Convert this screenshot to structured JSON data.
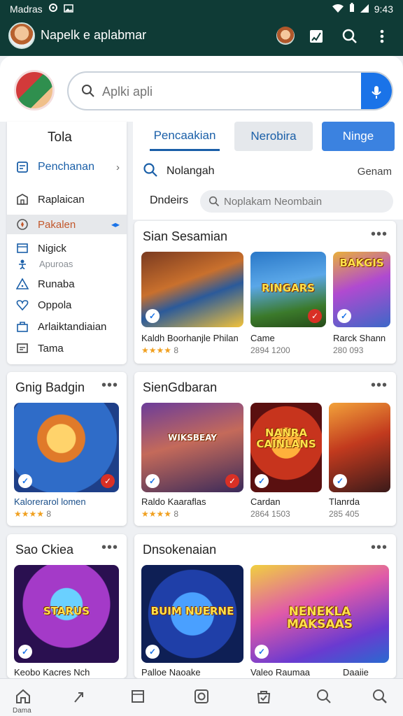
{
  "status_bar": {
    "carrier": "Madras",
    "time": "9:43"
  },
  "app_bar": {
    "title": "Napelk e aplabmar"
  },
  "search": {
    "placeholder": "Aplki apli"
  },
  "sidebar": {
    "heading": "Tola",
    "items": [
      {
        "label": "Penchanan",
        "icon": "tablet-icon"
      },
      {
        "label": "Raplaican",
        "icon": "building-icon"
      },
      {
        "label": "Pakalen",
        "icon": "compass-icon"
      },
      {
        "label": "Nigick",
        "icon": "window-icon"
      },
      {
        "label": "Apuroas",
        "icon": "person-icon"
      },
      {
        "label": "Runaba",
        "icon": "warning-icon"
      },
      {
        "label": "Oppola",
        "icon": "heart-icon"
      },
      {
        "label": "Arlaiktandiaian",
        "icon": "bag-icon"
      },
      {
        "label": "Tama",
        "icon": "id-card-icon"
      }
    ]
  },
  "tabs": [
    "Pencaakian",
    "Nerobira",
    "Ninge"
  ],
  "search_row": {
    "label": "Nolangah",
    "right_label": "Genam"
  },
  "filter_row": {
    "label": "Dndeirs",
    "placeholder": "Noplakam Neombain"
  },
  "cards": {
    "c1": {
      "title": "Sian Sesamian",
      "tiles": [
        {
          "name": "Kaldh Boorhanjle Philan",
          "meta": "8",
          "rating": "★★★★",
          "banner": ""
        },
        {
          "name": "Came",
          "meta": "2894 1200",
          "rating": "",
          "banner": "RINGARS"
        },
        {
          "name": "Rarck Shann",
          "meta": "280 093",
          "rating": "",
          "banner": "BAKGIS"
        }
      ]
    },
    "c2": {
      "title": "Gnig Badgin",
      "tiles": [
        {
          "name": "Kalorerarol lomen",
          "meta": "8",
          "rating": "★★★★",
          "banner": ""
        }
      ]
    },
    "c3": {
      "title": "SienGdbaran",
      "tiles": [
        {
          "name": "Raldo Kaaraflas",
          "meta": "8",
          "rating": "★★★★",
          "banner": "WIKSBEAY"
        },
        {
          "name": "Cardan",
          "meta": "2864 1503",
          "rating": "",
          "banner": "NANRA CAINLANS"
        },
        {
          "name": "Tlanrda",
          "meta": "285 405",
          "rating": "",
          "banner": ""
        }
      ]
    },
    "c4": {
      "title": "Sao Ckiea",
      "tiles": [
        {
          "name": "Keobo Kacres Nch",
          "meta": "",
          "rating": "",
          "banner": "STARUS"
        }
      ]
    },
    "c5": {
      "title": "Dnsokenaian",
      "tiles": [
        {
          "name": "Palloe Naoake",
          "meta": "",
          "rating": "",
          "banner": "BUIM NUERNE"
        },
        {
          "name": "Valeo Raumaa",
          "meta": "",
          "rating": "",
          "banner": "NENEKLA MAKSAAS"
        },
        {
          "name": "Daaiie",
          "meta": "",
          "rating": "",
          "banner": ""
        }
      ]
    }
  },
  "bottom_nav": {
    "home_label": "Dama",
    "icons": [
      "home-icon",
      "share-icon",
      "square-icon",
      "camera-icon",
      "bag-check-icon",
      "search-icon",
      "search-alt-icon"
    ]
  },
  "colors": {
    "app_bar": "#0f3b36",
    "accent": "#1a73e8",
    "star": "#f0a020"
  }
}
